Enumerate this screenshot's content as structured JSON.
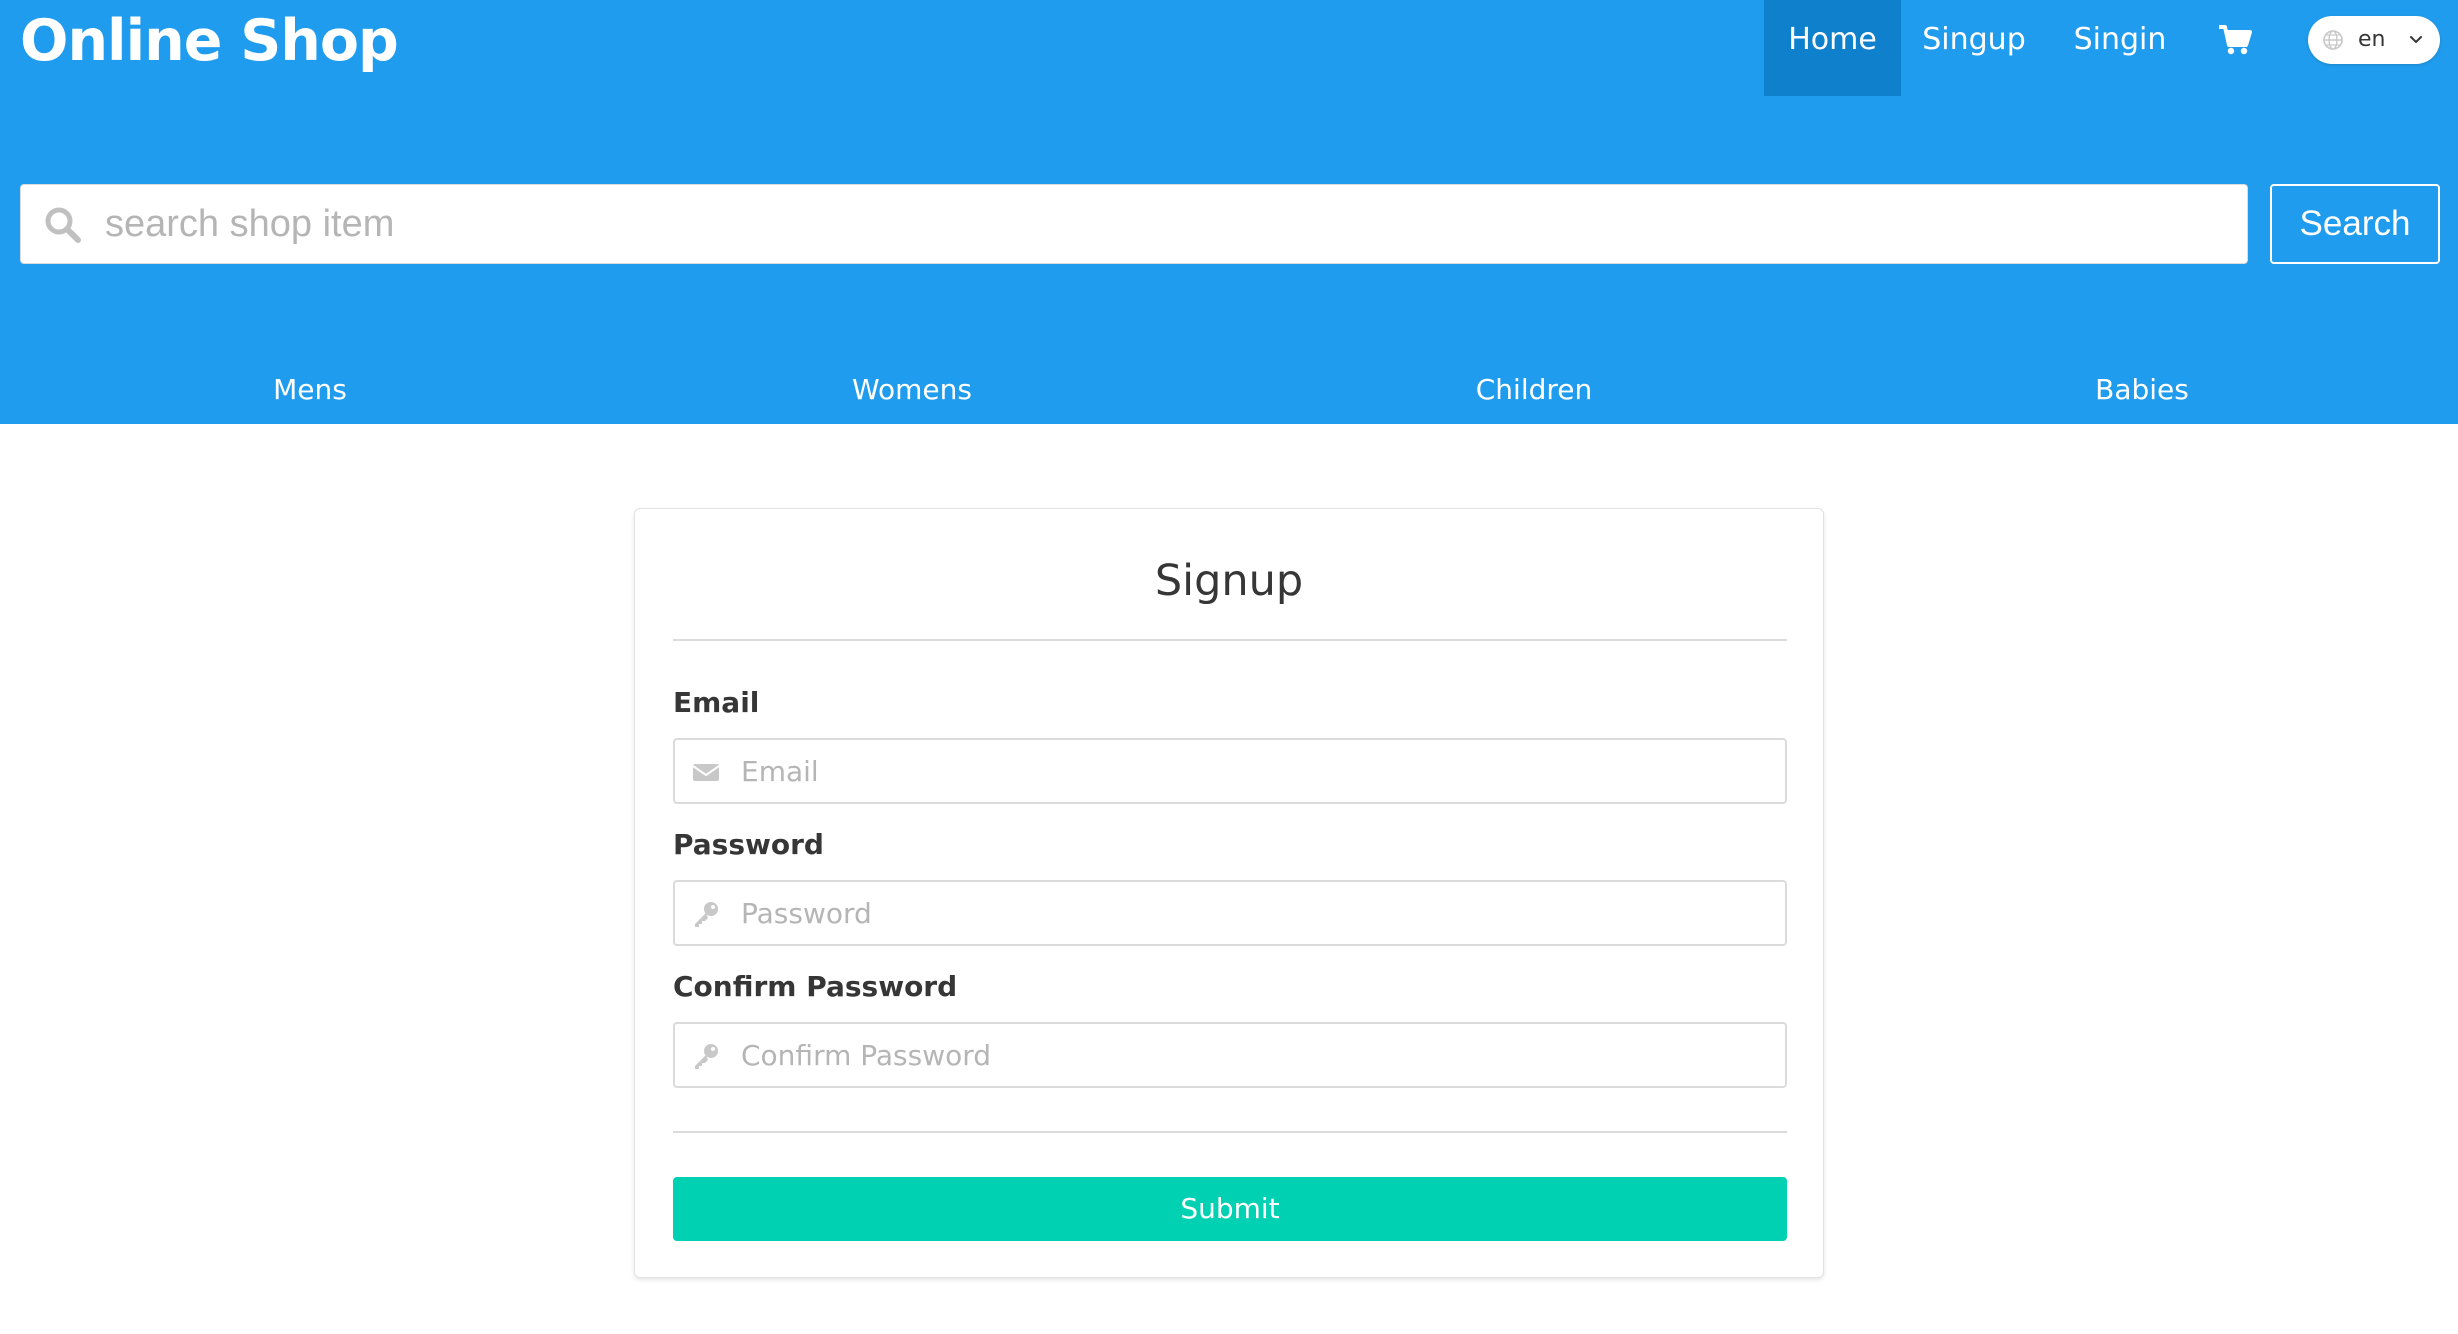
{
  "colors": {
    "header_bg": "#209cee",
    "nav_active_bg": "#0f81cc",
    "submit_bg": "#00d1b2"
  },
  "header": {
    "brand": "Online Shop",
    "nav": {
      "home": "Home",
      "signup": "Singup",
      "signin": "Singin",
      "cart_icon": "shopping-cart-icon"
    },
    "language": {
      "globe_icon": "globe-icon",
      "value": "en",
      "chevron_icon": "chevron-down-icon"
    },
    "search": {
      "icon": "search-icon",
      "placeholder": "search shop item",
      "button_label": "Search"
    },
    "categories": [
      "Mens",
      "Womens",
      "Children",
      "Babies"
    ]
  },
  "form": {
    "title": "Signup",
    "email": {
      "label": "Email",
      "placeholder": "Email",
      "icon": "envelope-icon"
    },
    "password": {
      "label": "Password",
      "placeholder": "Password",
      "icon": "key-icon"
    },
    "confirm_password": {
      "label": "Confirm Password",
      "placeholder": "Confirm Password",
      "icon": "key-icon"
    },
    "submit_label": "Submit"
  }
}
